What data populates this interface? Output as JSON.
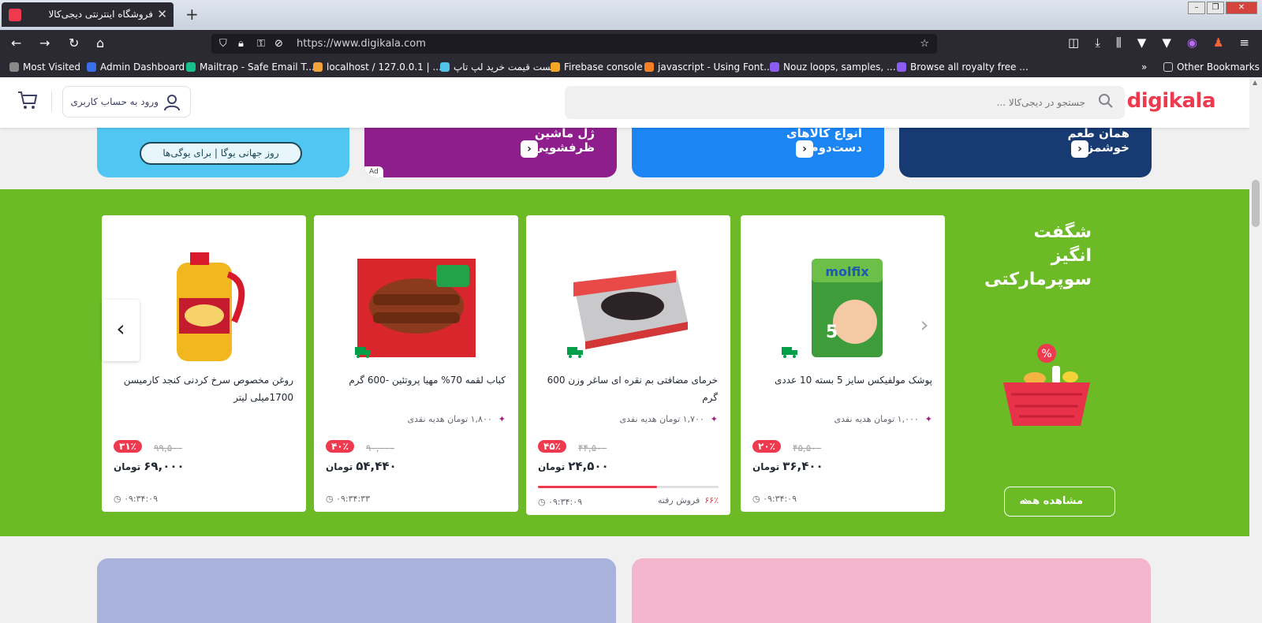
{
  "browser": {
    "tab_title": "فروشگاه اینترنتی دیجی‌کالا",
    "url": "https://www.digikala.com",
    "bookmarks": [
      "Most Visited",
      "Admin Dashboard",
      "Mailtrap - Safe Email T...",
      "localhost / 127.0.0.1 | ...",
      "لیست قیمت خرید لپ تاپ",
      "Firebase console",
      "javascript - Using Font...",
      "Nouz loops, samples, ...",
      "Browse all royalty free ..."
    ],
    "other_bookmarks": "Other Bookmarks"
  },
  "header": {
    "logo": "digikala",
    "search_placeholder": "جستجو در دیجی‌کالا ...",
    "login_label": "ورود به حساب کاربری"
  },
  "banners": [
    {
      "text": "روز جهانی یوگا | برای یوگی‌ها"
    },
    {
      "line1": "ژل ماشین",
      "line2": "ظرفشویی",
      "ad": "Ad"
    },
    {
      "line1": "انواع کالاهای",
      "line2": "دست‌دوم"
    },
    {
      "line1": "همان طعم",
      "line2": "خوشمزه"
    }
  ],
  "supermarket": {
    "promo_line1": "شگفت",
    "promo_line2": "انگیز",
    "promo_line3": "سوپرمارکتی",
    "see_all": "مشاهده همه",
    "accent": "#6bba26",
    "products": [
      {
        "name": "پوشک مولفیکس سایز 5 بسته 10 عددی",
        "gift": "۱,۰۰۰ تومان هدیه نقدی",
        "discount": "۲۰٪",
        "old_price": "۴۵,۵۰۰",
        "price": "۳۶,۴۰۰",
        "unit": "تومان",
        "timer": "۰۹:۳۴:۰۹"
      },
      {
        "name": "خرمای مضافتی بم نقره ای ساغر وزن 600 گرم",
        "gift": "۱,۷۰۰ تومان هدیه نقدی",
        "discount": "۴۵٪",
        "old_price": "۴۴,۵۰۰",
        "price": "۲۴,۵۰۰",
        "unit": "تومان",
        "timer": "۰۹:۳۴:۰۹",
        "sold_label": "فروش رفته",
        "sold_pct": "۶۶٪",
        "sold_fraction": 0.66
      },
      {
        "name": "کباب لقمه 70% مهیا پروتئین -600 گرم",
        "gift": "۱,۸۰۰ تومان هدیه نقدی",
        "discount": "۴۰٪",
        "old_price": "۹۰,۰۰۰",
        "price": "۵۴,۴۴۰",
        "unit": "تومان",
        "timer": "۰۹:۳۴:۳۳"
      },
      {
        "name": "روغن مخصوص سرخ کردنی کنجد کارمیسن   1700میلی لیتر",
        "gift": "",
        "discount": "۳۱٪",
        "old_price": "۹۹,۵۰۰",
        "price": "۶۹,۰۰۰",
        "unit": "تومان",
        "timer": "۰۹:۳۴:۰۹"
      }
    ]
  }
}
